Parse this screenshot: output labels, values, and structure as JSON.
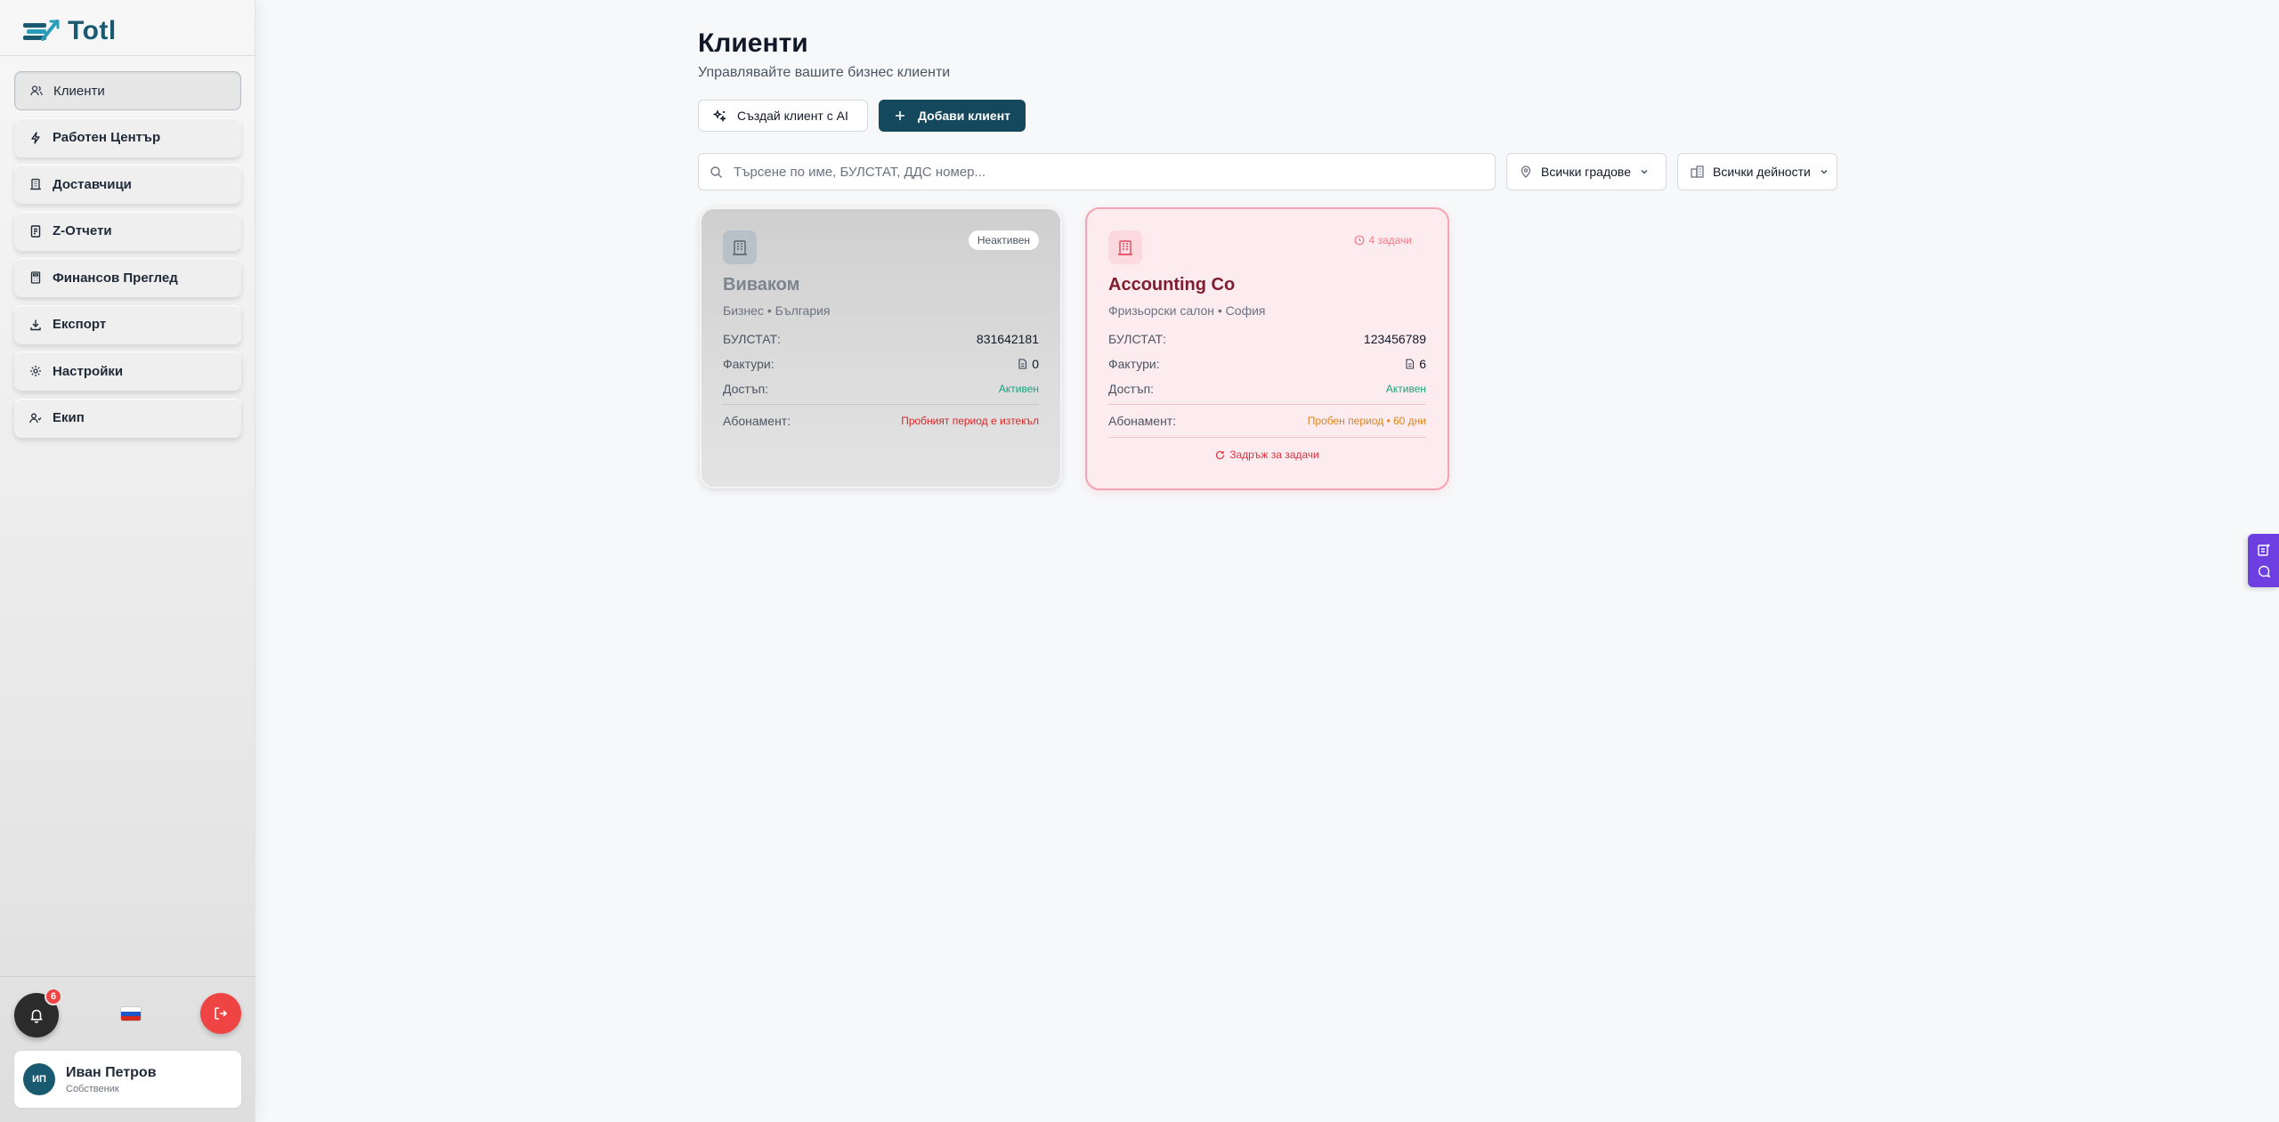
{
  "app": {
    "logo_text": "Totl"
  },
  "sidebar": {
    "items": [
      {
        "label": "Клиенти",
        "icon": "users-icon"
      },
      {
        "label": "Работен Център",
        "icon": "bolt-icon"
      },
      {
        "label": "Доставчици",
        "icon": "building-icon"
      },
      {
        "label": "Z-Отчети",
        "icon": "receipt-icon"
      },
      {
        "label": "Финансов Преглед",
        "icon": "calculator-icon"
      },
      {
        "label": "Експорт",
        "icon": "download-icon"
      },
      {
        "label": "Настройки",
        "icon": "gear-icon"
      },
      {
        "label": "Екип",
        "icon": "team-icon"
      }
    ],
    "notifications_count": "6",
    "user": {
      "initials": "ИП",
      "name": "Иван Петров",
      "role": "Собственик"
    }
  },
  "main": {
    "title": "Клиенти",
    "subtitle": "Управлявайте вашите бизнес клиенти",
    "buttons": {
      "ai_create": "Създай клиент с AI",
      "add_client": "Добави клиент"
    },
    "search": {
      "placeholder": "Търсене по име, БУЛСТАТ, ДДС номер..."
    },
    "filters": {
      "city": "Всички градове",
      "activity": "Всички дейности"
    }
  },
  "clients": [
    {
      "name": "Виваком",
      "type": "Бизнес • България",
      "badge": "Неактивен",
      "bulstat_label": "БУЛСТАТ:",
      "bulstat": "831642181",
      "invoices_label": "Фактури:",
      "invoices": "0",
      "access_label": "Достъп:",
      "access": "Активен",
      "subscription_label": "Абонамент:",
      "subscription": "Пробният период е изтекъл"
    },
    {
      "name": "Accounting Co",
      "type": "Фризьорски салон • София",
      "badge": "4 задачи",
      "bulstat_label": "БУЛСТАТ:",
      "bulstat": "123456789",
      "invoices_label": "Фактури:",
      "invoices": "6",
      "access_label": "Достъп:",
      "access": "Активен",
      "subscription_label": "Абонамент:",
      "subscription": "Пробен период • 60 дни",
      "retry": "Задръж за задачи"
    }
  ],
  "colors": {
    "brand": "#14485c",
    "danger": "#ef4444",
    "success": "#16a37a",
    "warning": "#e0841c",
    "widget": "#6d3ee0"
  }
}
